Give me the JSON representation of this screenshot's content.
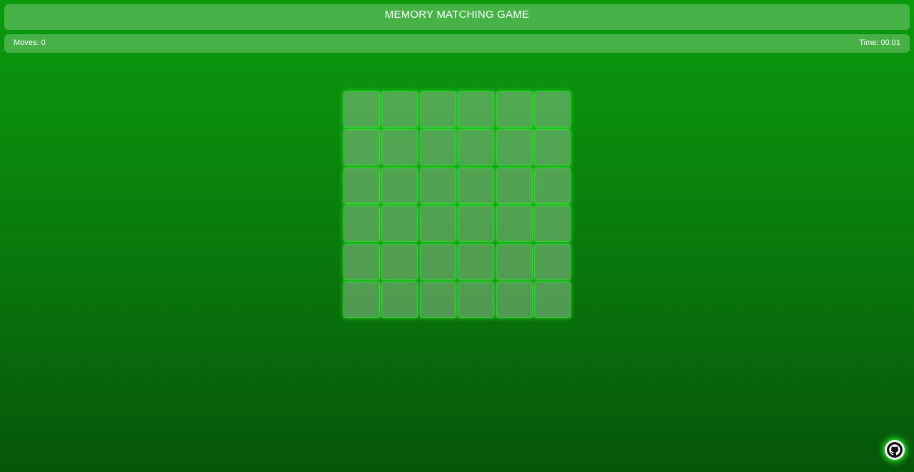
{
  "header": {
    "title": "MEMORY MATCHING GAME"
  },
  "status": {
    "moves_text": "Moves: 0",
    "time_text": "Time: 00:01"
  },
  "board": {
    "rows": 6,
    "columns": 6,
    "cards_face_down": 36
  },
  "footer": {
    "github_icon": "github-icon"
  },
  "colors": {
    "background_top": "#0b9a0d",
    "background_bottom": "#06560a",
    "card_border_glow": "#2fd12f"
  }
}
